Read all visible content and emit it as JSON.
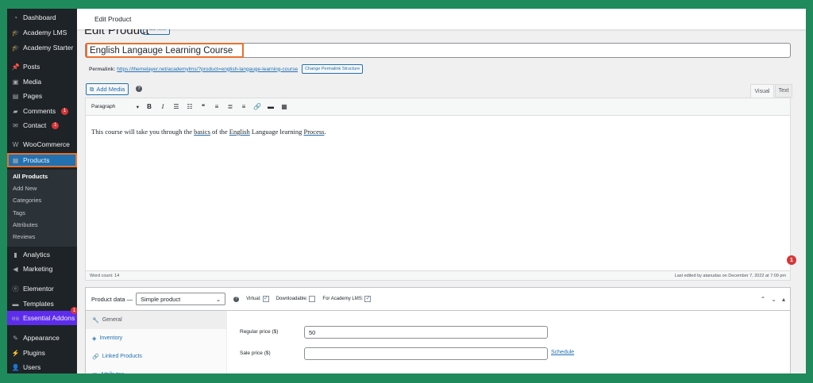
{
  "sidebar": {
    "items": [
      {
        "label": "Dashboard",
        "icon": "dashboard-icon",
        "glyph": "◔"
      },
      {
        "label": "Academy LMS",
        "icon": "graduation-cap-icon",
        "glyph": "🎓"
      },
      {
        "label": "Academy Starter",
        "icon": "graduation-cap-icon",
        "glyph": "🎓"
      },
      {
        "label": "Posts",
        "icon": "pin-icon",
        "glyph": "📌"
      },
      {
        "label": "Media",
        "icon": "media-icon",
        "glyph": "▣"
      },
      {
        "label": "Pages",
        "icon": "pages-icon",
        "glyph": "▤"
      },
      {
        "label": "Comments",
        "icon": "comment-icon",
        "glyph": "▰",
        "badge": "1"
      },
      {
        "label": "Contact",
        "icon": "mail-icon",
        "glyph": "✉",
        "badge": "1"
      },
      {
        "label": "WooCommerce",
        "icon": "woo-icon",
        "glyph": "W"
      },
      {
        "label": "Products",
        "icon": "products-icon",
        "glyph": "▦"
      },
      {
        "label": "Analytics",
        "icon": "chart-icon",
        "glyph": "▮"
      },
      {
        "label": "Marketing",
        "icon": "megaphone-icon",
        "glyph": "◀"
      },
      {
        "label": "Elementor",
        "icon": "elementor-icon",
        "glyph": "ⓔ"
      },
      {
        "label": "Templates",
        "icon": "folder-icon",
        "glyph": "▬"
      },
      {
        "label": "Essential Addons",
        "icon": "ea-icon",
        "glyph": "ea",
        "badge": "1"
      },
      {
        "label": "Appearance",
        "icon": "brush-icon",
        "glyph": "✎"
      },
      {
        "label": "Plugins",
        "icon": "plug-icon",
        "glyph": "⚡"
      },
      {
        "label": "Users",
        "icon": "user-icon",
        "glyph": "👤"
      }
    ],
    "submenu": [
      "All Products",
      "Add New",
      "Categories",
      "Tags",
      "Attributes",
      "Reviews"
    ]
  },
  "topbar": {
    "title": "Edit Product"
  },
  "heading": {
    "text": "Edit Product",
    "add_new": "Add New"
  },
  "post": {
    "title": "English Langauge Learning Course",
    "permalink_label": "Permalink:",
    "permalink_url": "https://themelayer.net/academylms/?product=english-langauge-learning-course",
    "permalink_button": "Change Permalink Structure"
  },
  "editor": {
    "add_media": "Add Media",
    "tabs": {
      "visual": "Visual",
      "text": "Text"
    },
    "format": "Paragraph",
    "toolbar_icons": [
      {
        "name": "bold-icon",
        "glyph": "B"
      },
      {
        "name": "italic-icon",
        "glyph": "I"
      },
      {
        "name": "bulleted-list-icon",
        "glyph": "☰"
      },
      {
        "name": "numbered-list-icon",
        "glyph": "☷"
      },
      {
        "name": "blockquote-icon",
        "glyph": "❝"
      },
      {
        "name": "align-left-icon",
        "glyph": "≡"
      },
      {
        "name": "align-center-icon",
        "glyph": "≣"
      },
      {
        "name": "align-right-icon",
        "glyph": "≡"
      },
      {
        "name": "link-icon",
        "glyph": "🔗"
      },
      {
        "name": "read-more-icon",
        "glyph": "▬"
      },
      {
        "name": "toolbar-toggle-icon",
        "glyph": "▦"
      }
    ],
    "content": [
      "This course will take you through the ",
      "basics",
      " of the ",
      "English",
      " Language learning ",
      "Process",
      "."
    ],
    "word_count": "Word count: 14",
    "last_edited": "Last edited by atanudas on December 7, 2022 at 7:09 pm",
    "notification": "1"
  },
  "product_data": {
    "label": "Product data —",
    "type": "Simple product",
    "virtual": "Virtual:",
    "downloadable": "Downloadable:",
    "academy": "For Academy LMS:",
    "virtual_checked": true,
    "downloadable_checked": false,
    "academy_checked": true,
    "tabs": [
      {
        "label": "General",
        "icon": "wrench-icon",
        "glyph": "🔧"
      },
      {
        "label": "Inventory",
        "icon": "tag-icon",
        "glyph": "◈"
      },
      {
        "label": "Linked Products",
        "icon": "link-icon",
        "glyph": "🔗"
      },
      {
        "label": "Attributes",
        "icon": "list-icon",
        "glyph": "▦"
      }
    ],
    "regular_price_label": "Regular price ($)",
    "regular_price": "50",
    "sale_price_label": "Sale price ($)",
    "sale_price": "",
    "schedule": "Schedule"
  }
}
